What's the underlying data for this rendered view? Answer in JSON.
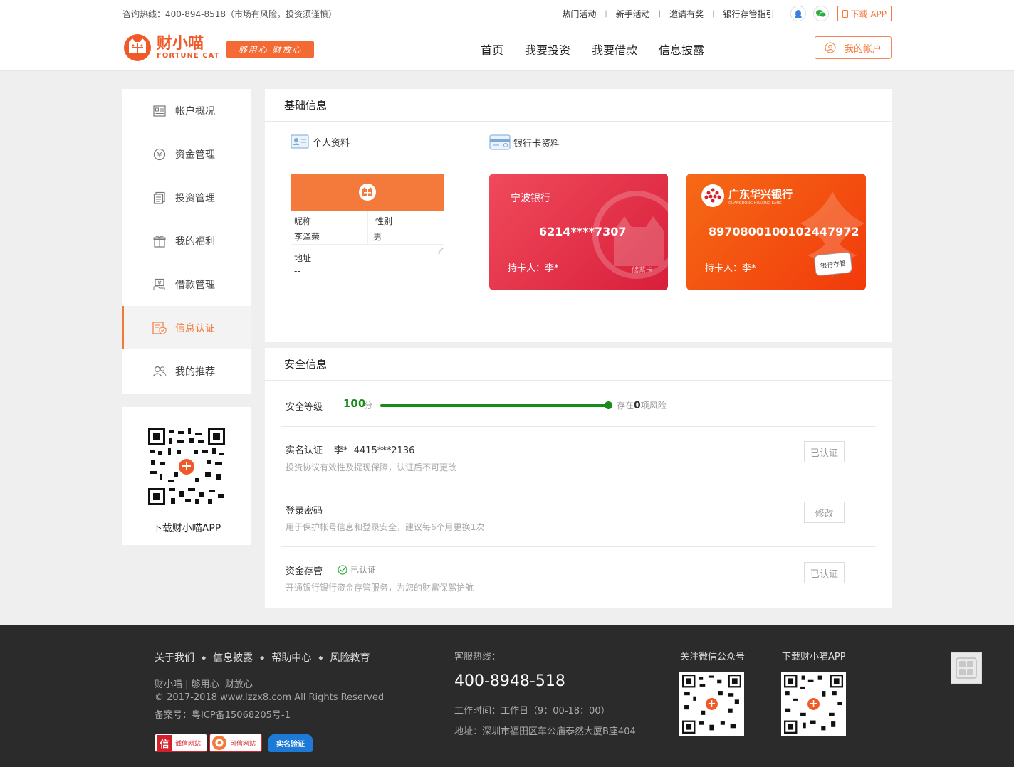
{
  "topbar": {
    "hotline": "咨询热线：400-894-8518（市场有风险，投资须谨慎）",
    "links": [
      "热门活动",
      "新手活动",
      "邀请有奖",
      "银行存管指引"
    ],
    "download_app": "下载 APP"
  },
  "header": {
    "logo_cn": "财小喵",
    "logo_en": "FORTUNE CAT",
    "slogan": "够用心 财放心",
    "nav": [
      "首页",
      "我要投资",
      "我要借款",
      "信息披露"
    ],
    "my_account": "我的帐户"
  },
  "sidebar": {
    "items": [
      {
        "label": "帐户概况",
        "icon": "account-overview-icon"
      },
      {
        "label": "资金管理",
        "icon": "funds-icon"
      },
      {
        "label": "投资管理",
        "icon": "investment-icon"
      },
      {
        "label": "我的福利",
        "icon": "gift-icon"
      },
      {
        "label": "借款管理",
        "icon": "loan-icon"
      },
      {
        "label": "信息认证",
        "icon": "certification-icon",
        "active": true
      },
      {
        "label": "我的推荐",
        "icon": "referral-icon"
      }
    ],
    "qr_caption": "下载财小喵APP"
  },
  "basic_info": {
    "title": "基础信息",
    "personal_label": "个人资料",
    "bank_label": "银行卡资料",
    "profile": {
      "nickname_label": "昵称",
      "nickname": "李泽荣",
      "gender_label": "性别",
      "gender": "男",
      "address_label": "地址",
      "address": "--"
    },
    "cards": [
      {
        "bank": "宁波银行",
        "number": "6214****7307",
        "holder": "持卡人：李*",
        "type": "储蓄卡",
        "color": "#e8344a"
      },
      {
        "bank": "广东华兴银行",
        "bank_en": "GUANGDONG HUAXING BANK",
        "number": "8970800100102447972",
        "holder": "持卡人：李*",
        "tag": "银行存管",
        "color": "#f24c12"
      }
    ]
  },
  "security": {
    "title": "安全信息",
    "level_label": "安全等级",
    "score": "100",
    "score_unit": "分",
    "score_percent": 100,
    "risk_prefix": "存在",
    "risk_count": "0",
    "risk_suffix": "项风险",
    "rows": [
      {
        "title": "实名认证",
        "detail": "李*  4415***2136",
        "desc": "投资协议有效性及提现保障，认证后不可更改",
        "button": "已认证"
      },
      {
        "title": "登录密码",
        "desc": "用于保护帐号信息和登录安全，建议每6个月更换1次",
        "button": "修改"
      },
      {
        "title": "资金存管",
        "status": "已认证",
        "desc": "开通银行银行资金存管服务，为您的财富保驾护航",
        "button": "已认证"
      }
    ]
  },
  "footer": {
    "links": [
      "关于我们",
      "信息披露",
      "帮助中心",
      "风险教育"
    ],
    "slogan": "财小喵 | 够用心  财放心",
    "copyright": "© 2017-2018 www.lzzx8.com All Rights Reserved",
    "icp": "备案号：粤ICP备15068205号-1",
    "hotline_label": "客服热线：",
    "hotline": "400-8948-518",
    "hours": "工作时间：工作日（9：00-18：00）",
    "address": "地址：深圳市福田区车公庙泰然大厦B座404",
    "wechat_label": "关注微信公众号",
    "app_label": "下载财小喵APP",
    "badges": [
      "诚信网站",
      "可信网站",
      "实名验证"
    ]
  },
  "colors": {
    "accent": "#f47a3c",
    "progress": "#1a8a1a"
  }
}
